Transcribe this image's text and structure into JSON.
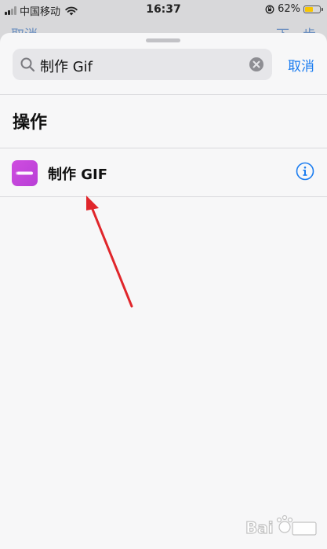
{
  "status_bar": {
    "carrier": "中国移动",
    "time": "16:37",
    "battery_percent": "62%",
    "battery_level": 0.62
  },
  "underlying_nav": {
    "left": "取消",
    "right": "下一步"
  },
  "search": {
    "value": "制作 Gif",
    "cancel_label": "取消"
  },
  "section": {
    "title": "操作"
  },
  "actions": [
    {
      "label": "制作 GIF",
      "icon": "gif-action-icon",
      "accent": "#c94ade"
    }
  ],
  "colors": {
    "accent_blue": "#1a7cf0",
    "arrow_red": "#e0262b"
  }
}
